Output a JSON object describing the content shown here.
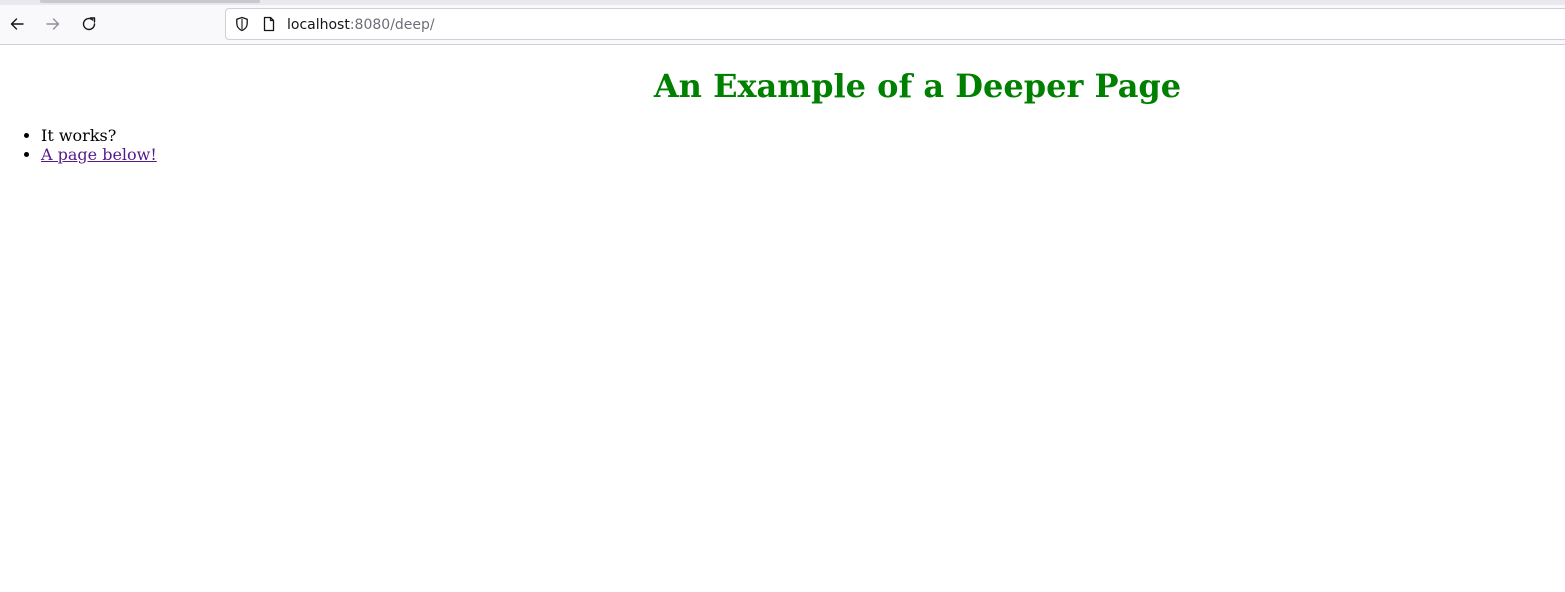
{
  "browser": {
    "url_host": "localhost",
    "url_rest": ":8080/deep/",
    "icons": {
      "back": "arrow-left-icon",
      "forward": "arrow-right-icon",
      "reload": "reload-icon",
      "tracking_protection": "shield-icon",
      "page_info": "page-icon"
    }
  },
  "page": {
    "heading": "An Example of a Deeper Page",
    "heading_color": "#008000",
    "items": [
      {
        "text": "It works?"
      },
      {
        "text": "A page below!",
        "is_link": true,
        "link_color": "#551a8b"
      }
    ]
  }
}
